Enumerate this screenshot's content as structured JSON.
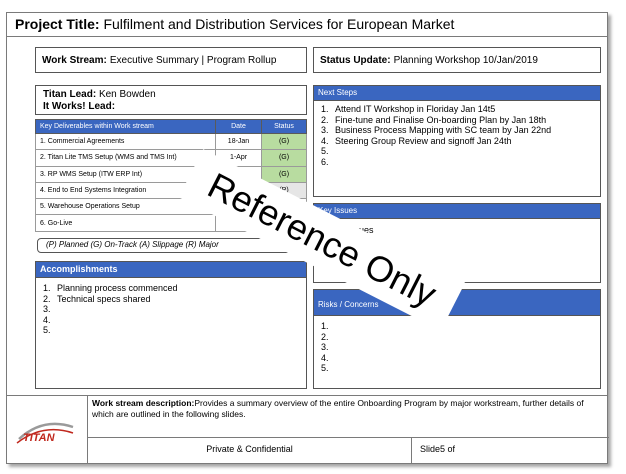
{
  "project_title": {
    "label": "Project Title:",
    "value": "Fulfilment and Distribution Services for European Market"
  },
  "work_stream": {
    "label": "Work Stream:",
    "value": "Executive Summary | Program Rollup"
  },
  "status_update": {
    "label": "Status Update:",
    "value": "Planning Workshop 10/Jan/2019"
  },
  "leads": {
    "titan_label": "Titan Lead:",
    "titan_value": "Ken Bowden",
    "itworks_label": "It Works! Lead:",
    "itworks_value": ""
  },
  "deliverables": {
    "headers": [
      "Key Deliverables within Work stream",
      "Date",
      "Status"
    ],
    "rows": [
      {
        "name": "1. Commercial Agreements",
        "date": "18-Jan",
        "status": "(G)"
      },
      {
        "name": "2. Titan Lite TMS Setup (WMS and TMS Int)",
        "date": "1-Apr",
        "status": "(G)"
      },
      {
        "name": "3. RP WMS Setup (ITW ERP Int)",
        "date": "1-Apr",
        "status": "(G)"
      },
      {
        "name": "4. End to End Systems Integration",
        "date": "",
        "status": "(P)"
      },
      {
        "name": "5. Warehouse Operations Setup",
        "date": "",
        "status": ""
      },
      {
        "name": "6. Go-Live",
        "date": "",
        "status": ""
      }
    ]
  },
  "legend": "(P) Planned (G) On-Track (A) Slippage (R) Major",
  "next_steps": {
    "title": "Next Steps",
    "items": [
      {
        "n": "1.",
        "text": "Attend IT Workshop in Floriday Jan 14t5"
      },
      {
        "n": "2.",
        "text": "Fine-tune and Finalise On-boarding Plan by Jan 18th"
      },
      {
        "n": "3.",
        "text": "Business Process Mapping with SC team by Jan 22nd"
      },
      {
        "n": "4.",
        "text": "Steering Group Review and signoff Jan 24th"
      },
      {
        "n": "5.",
        "text": ""
      },
      {
        "n": "6.",
        "text": ""
      }
    ]
  },
  "key_issues": {
    "title": "Key Issues",
    "text": "No issues"
  },
  "accomplishments": {
    "title": "Accomplishments",
    "items": [
      {
        "n": "1.",
        "text": "Planning process commenced"
      },
      {
        "n": "2.",
        "text": "Technical specs shared"
      },
      {
        "n": "3.",
        "text": ""
      },
      {
        "n": "4.",
        "text": ""
      },
      {
        "n": "5.",
        "text": ""
      }
    ]
  },
  "risks": {
    "title": "Risks / Concerns",
    "items": [
      {
        "n": "1.",
        "text": ""
      },
      {
        "n": "2.",
        "text": ""
      },
      {
        "n": "3.",
        "text": ""
      },
      {
        "n": "4.",
        "text": ""
      },
      {
        "n": "5.",
        "text": ""
      }
    ]
  },
  "footer": {
    "desc_label": "Work stream description:",
    "desc_text": "Provides a summary overview of the entire Onboarding Program by major workstream, further details of which are outlined in the following slides.",
    "private": "Private & Confidential",
    "slide": "Slide5 of"
  },
  "logo": {
    "text": "TITAN",
    "color": "#c0281e"
  },
  "watermark": "Reference Only",
  "colors": {
    "header_blue": "#3a66c0",
    "status_green": "#b8dca0",
    "status_grey": "#e6e6e6"
  }
}
